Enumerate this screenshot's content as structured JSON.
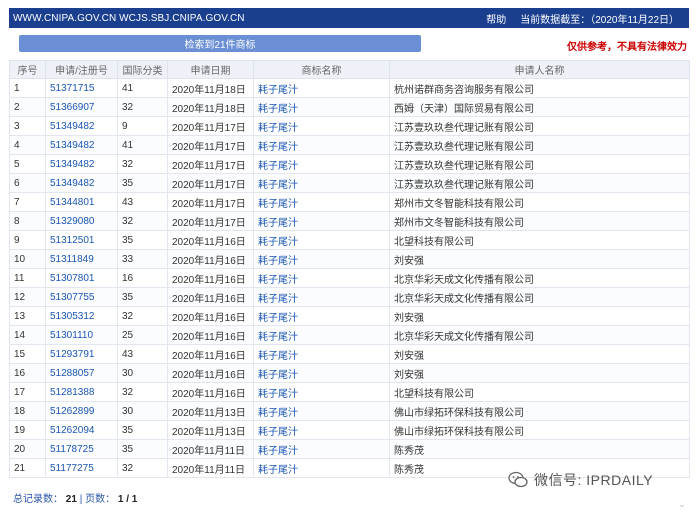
{
  "header": {
    "site_text": "WWW.CNIPA.GOV.CN WCJS.SBJ.CNIPA.GOV.CN",
    "help_label": "帮助",
    "data_date": "当前数据截至：（2020年11月22日）"
  },
  "search": {
    "result_label": "检索到21件商标",
    "disclaimer": "仅供参考，不具有法律效力"
  },
  "table": {
    "headers": [
      "序号",
      "申请/注册号",
      "国际分类",
      "申请日期",
      "商标名称",
      "申请人名称"
    ],
    "rows": [
      {
        "no": "1",
        "reg": "51371715",
        "cls": "41",
        "date": "2020年11月18日",
        "mark": "耗子尾汁",
        "applicant": "杭州诺群商务咨询服务有限公司"
      },
      {
        "no": "2",
        "reg": "51366907",
        "cls": "32",
        "date": "2020年11月18日",
        "mark": "耗子尾汁",
        "applicant": "西姆（天津）国际贸易有限公司"
      },
      {
        "no": "3",
        "reg": "51349482",
        "cls": "9",
        "date": "2020年11月17日",
        "mark": "耗子尾汁",
        "applicant": "江苏壹玖玖叁代理记账有限公司"
      },
      {
        "no": "4",
        "reg": "51349482",
        "cls": "41",
        "date": "2020年11月17日",
        "mark": "耗子尾汁",
        "applicant": "江苏壹玖玖叁代理记账有限公司"
      },
      {
        "no": "5",
        "reg": "51349482",
        "cls": "32",
        "date": "2020年11月17日",
        "mark": "耗子尾汁",
        "applicant": "江苏壹玖玖叁代理记账有限公司"
      },
      {
        "no": "6",
        "reg": "51349482",
        "cls": "35",
        "date": "2020年11月17日",
        "mark": "耗子尾汁",
        "applicant": "江苏壹玖玖叁代理记账有限公司"
      },
      {
        "no": "7",
        "reg": "51344801",
        "cls": "43",
        "date": "2020年11月17日",
        "mark": "耗子尾汁",
        "applicant": "郑州市文冬智能科技有限公司"
      },
      {
        "no": "8",
        "reg": "51329080",
        "cls": "32",
        "date": "2020年11月17日",
        "mark": "耗子尾汁",
        "applicant": "郑州市文冬智能科技有限公司"
      },
      {
        "no": "9",
        "reg": "51312501",
        "cls": "35",
        "date": "2020年11月16日",
        "mark": "耗子尾汁",
        "applicant": "北望科技有限公司"
      },
      {
        "no": "10",
        "reg": "51311849",
        "cls": "33",
        "date": "2020年11月16日",
        "mark": "耗子尾汁",
        "applicant": "刘安强"
      },
      {
        "no": "11",
        "reg": "51307801",
        "cls": "16",
        "date": "2020年11月16日",
        "mark": "耗子尾汁",
        "applicant": "北京华彩天成文化传播有限公司"
      },
      {
        "no": "12",
        "reg": "51307755",
        "cls": "35",
        "date": "2020年11月16日",
        "mark": "耗子尾汁",
        "applicant": "北京华彩天成文化传播有限公司"
      },
      {
        "no": "13",
        "reg": "51305312",
        "cls": "32",
        "date": "2020年11月16日",
        "mark": "耗子尾汁",
        "applicant": "刘安强"
      },
      {
        "no": "14",
        "reg": "51301110",
        "cls": "25",
        "date": "2020年11月16日",
        "mark": "耗子尾汁",
        "applicant": "北京华彩天成文化传播有限公司"
      },
      {
        "no": "15",
        "reg": "51293791",
        "cls": "43",
        "date": "2020年11月16日",
        "mark": "耗子尾汁",
        "applicant": "刘安强"
      },
      {
        "no": "16",
        "reg": "51288057",
        "cls": "30",
        "date": "2020年11月16日",
        "mark": "耗子尾汁",
        "applicant": "刘安强"
      },
      {
        "no": "17",
        "reg": "51281388",
        "cls": "32",
        "date": "2020年11月16日",
        "mark": "耗子尾汁",
        "applicant": "北望科技有限公司"
      },
      {
        "no": "18",
        "reg": "51262899",
        "cls": "30",
        "date": "2020年11月13日",
        "mark": "耗子尾汁",
        "applicant": "佛山市绿拓环保科技有限公司"
      },
      {
        "no": "19",
        "reg": "51262094",
        "cls": "35",
        "date": "2020年11月13日",
        "mark": "耗子尾汁",
        "applicant": "佛山市绿拓环保科技有限公司"
      },
      {
        "no": "20",
        "reg": "51178725",
        "cls": "35",
        "date": "2020年11月11日",
        "mark": "耗子尾汁",
        "applicant": "陈秀茂"
      },
      {
        "no": "21",
        "reg": "51177275",
        "cls": "32",
        "date": "2020年11月11日",
        "mark": "耗子尾汁",
        "applicant": "陈秀茂"
      }
    ]
  },
  "footer": {
    "total_label": "总记录数：",
    "total_value": "21",
    "separator": " | ",
    "pages_label": "页数：",
    "pages_value": "1 / 1"
  },
  "watermark": {
    "icon": "wechat-icon",
    "text": "微信号: IPRDAILY"
  },
  "colors": {
    "topbar_bg": "#1a3f8f",
    "button_bg": "#6a8fd4",
    "link": "#1a56b4",
    "disclaimer": "#cc0000"
  }
}
